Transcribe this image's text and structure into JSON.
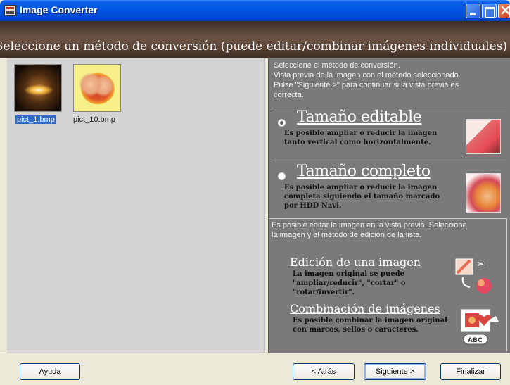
{
  "window": {
    "title": "Image Converter",
    "header": "Seleccione un método de conversión (puede editar/combinar imágenes individuales)"
  },
  "files": [
    {
      "name": "pict_1.bmp",
      "selected": true
    },
    {
      "name": "pict_10.bmp",
      "selected": false
    }
  ],
  "instructions": [
    "Seleccione el método de conversión.",
    "Vista previa de la imagen con el método seleccionado.",
    "Pulse \"Siguiente >\" para continuar si la vista previa es",
    "correcta."
  ],
  "options": [
    {
      "title": "Tamaño editable",
      "checked": true,
      "desc": [
        "Es posible ampliar o reducir la imagen",
        "tanto vertical como horizontalmente."
      ]
    },
    {
      "title": "Tamaño completo",
      "checked": false,
      "desc": [
        "Es posible ampliar o reducir la imagen",
        "completa siguiendo el tamaño marcado",
        "por HDD Navi."
      ]
    }
  ],
  "edit_intro": [
    "Es posible editar la imagen en la vista previa. Seleccione",
    "la imagen y el método de edición de la lista."
  ],
  "edit_single": {
    "title": "Edición de una imagen",
    "desc": [
      "La imagen original se puede",
      "\"ampliar/reducir\", \"cortar\" o",
      "\"rotar/invertir\"."
    ]
  },
  "edit_combine": {
    "title": "Combinación de imágenes",
    "desc": [
      "Es posible combinar la imagen original",
      "con marcos, sellos o caracteres."
    ],
    "badge": "ABC"
  },
  "buttons": {
    "help": "Ayuda",
    "back": "< Atrás",
    "next": "Siguiente >",
    "finish": "Finalizar"
  },
  "colors": {
    "titlebar": "#0054e3",
    "header": "#5d4537",
    "panel": "#7a7a7a",
    "selection": "#316ac5"
  }
}
